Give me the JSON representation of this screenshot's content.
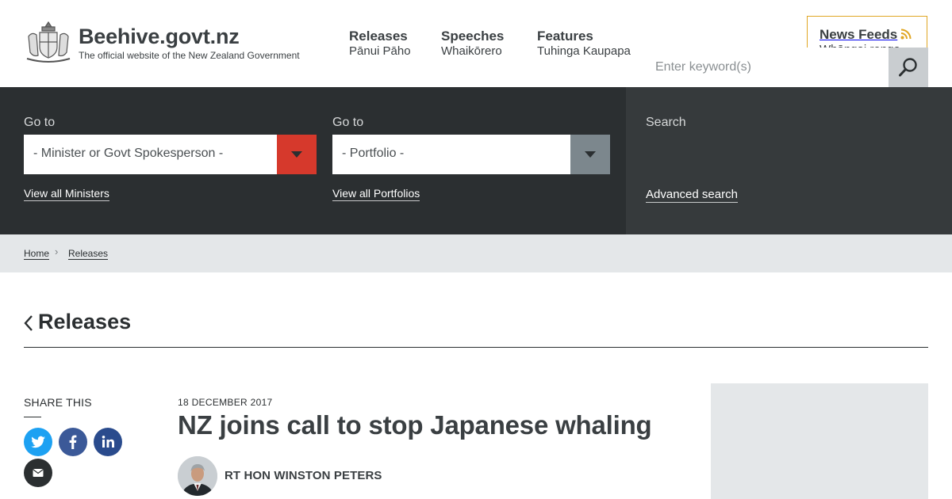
{
  "header": {
    "site_title": "Beehive.govt.nz",
    "tagline": "The official website of the New Zealand Government",
    "nav": [
      {
        "label": "Releases",
        "sublabel": "Pānui Pāho"
      },
      {
        "label": "Speeches",
        "sublabel": "Whaikōrero"
      },
      {
        "label": "Features",
        "sublabel": "Tuhinga Kaupapa"
      }
    ],
    "news_feeds": {
      "label": "News Feeds",
      "sublabel": "Whāngai rongo",
      "icon": "rss-icon"
    }
  },
  "tools": {
    "minister": {
      "label": "Go to",
      "selected": "- Minister or Govt Spokesperson -",
      "link": "View all Ministers",
      "button_color": "#d6392c"
    },
    "portfolio": {
      "label": "Go to",
      "selected": "- Portfolio -",
      "link": "View all Portfolios",
      "button_color": "#7c878d"
    },
    "search": {
      "label": "Search",
      "placeholder": "Enter keyword(s)",
      "value": "",
      "link": "Advanced search",
      "icon": "search-icon"
    }
  },
  "breadcrumb": [
    "Home",
    "Releases"
  ],
  "section": {
    "title": "Releases"
  },
  "share": {
    "label": "SHARE THIS",
    "buttons": [
      {
        "name": "twitter",
        "color": "#1da1f2"
      },
      {
        "name": "facebook",
        "color": "#3b5998"
      },
      {
        "name": "linkedin",
        "color": "#2a4b8d"
      },
      {
        "name": "email",
        "color": "#2b2f31"
      }
    ]
  },
  "article": {
    "date": "18 DECEMBER 2017",
    "title": "NZ joins call to stop Japanese whaling",
    "minister": "RT HON WINSTON PETERS"
  }
}
